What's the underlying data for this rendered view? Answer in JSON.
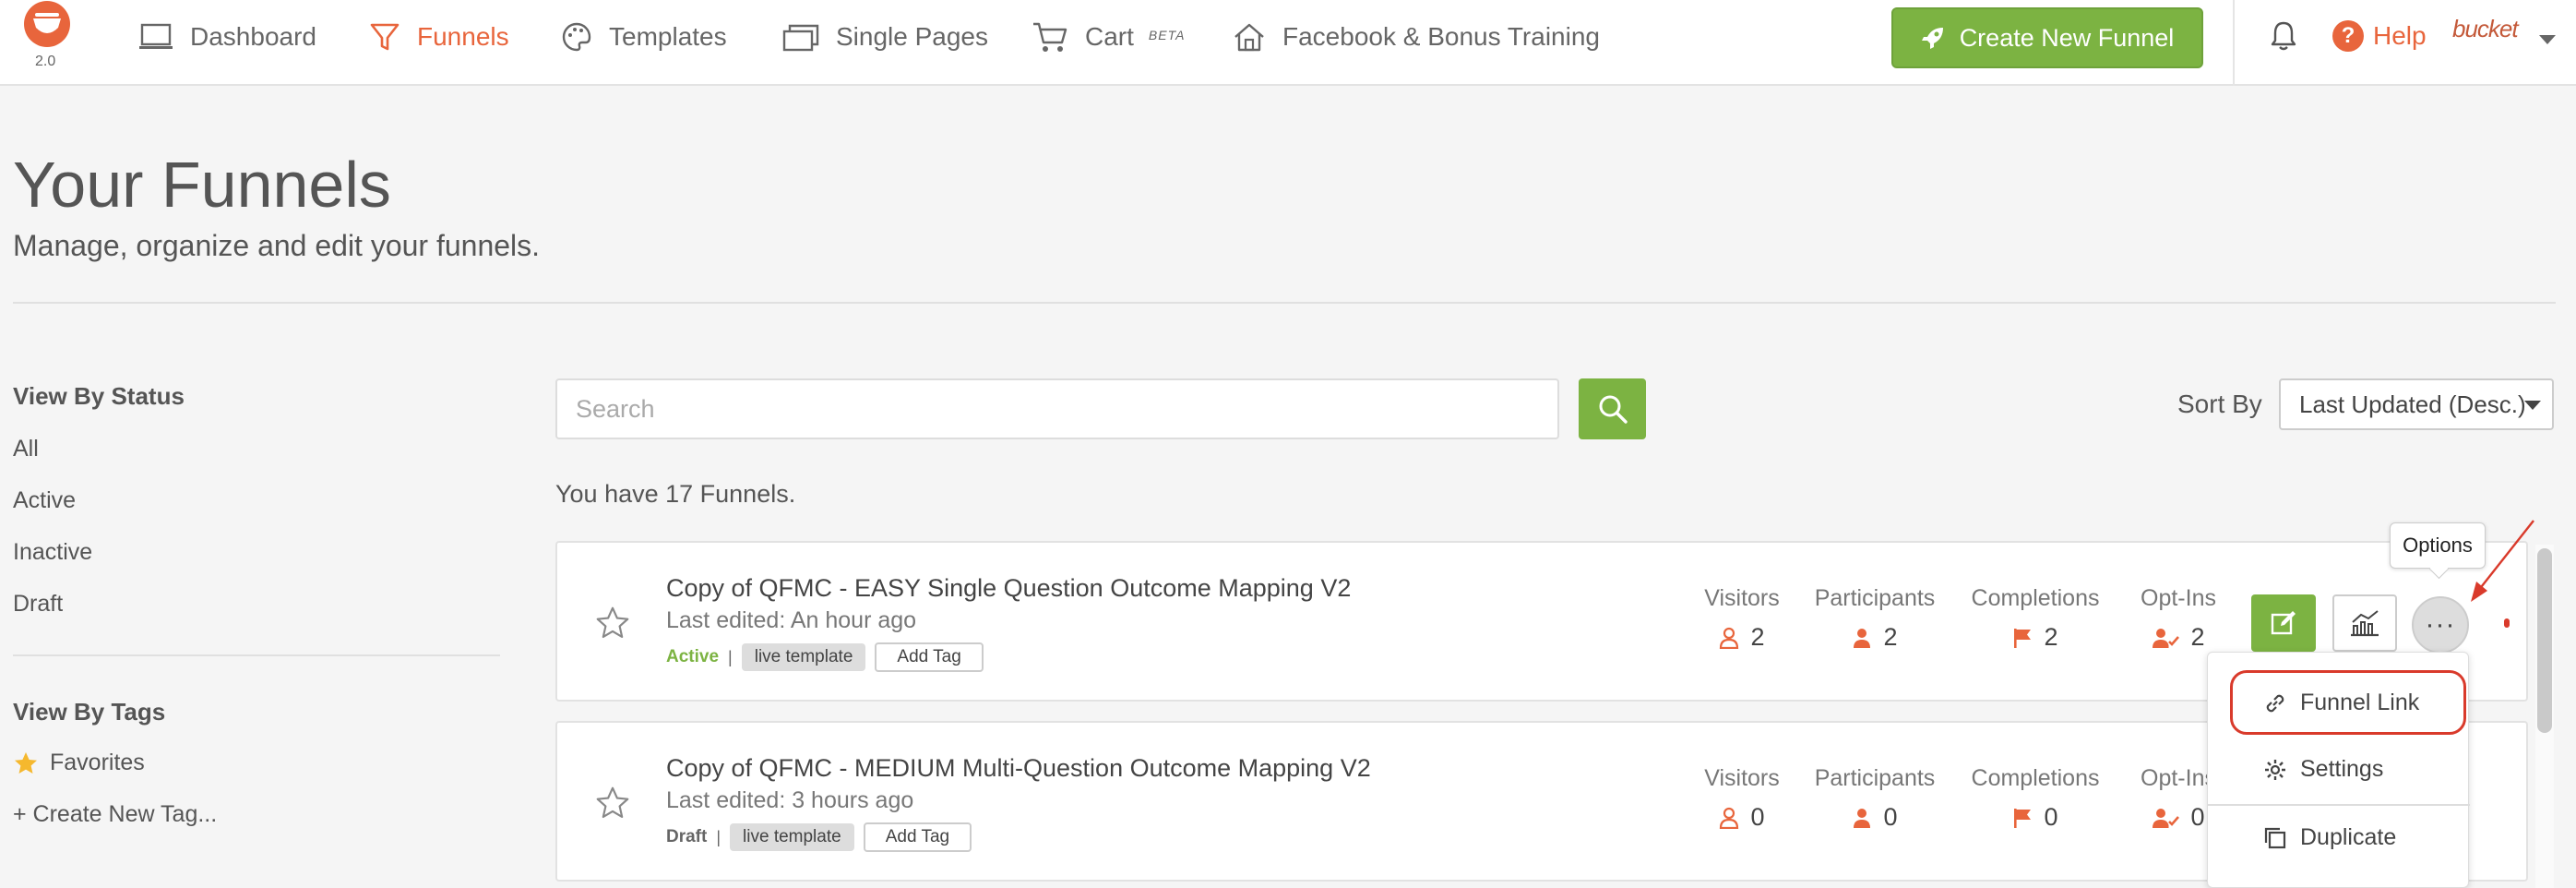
{
  "nav": {
    "logo_version": "2.0",
    "items": [
      {
        "label": "Dashboard",
        "icon": "laptop-icon"
      },
      {
        "label": "Funnels",
        "icon": "funnel-icon",
        "active": true
      },
      {
        "label": "Templates",
        "icon": "palette-icon"
      },
      {
        "label": "Single Pages",
        "icon": "pages-icon"
      },
      {
        "label": "Cart",
        "icon": "cart-icon",
        "badge": "BETA"
      },
      {
        "label": "Facebook & Bonus Training",
        "icon": "home-icon"
      }
    ],
    "create_button": "Create New Funnel",
    "help_label": "Help",
    "help_symbol": "?",
    "account_logo_text": "bucket"
  },
  "header": {
    "title": "Your Funnels",
    "subtitle": "Manage, organize and edit your funnels."
  },
  "sidebar": {
    "status_heading": "View By Status",
    "status_items": [
      "All",
      "Active",
      "Inactive",
      "Draft"
    ],
    "tags_heading": "View By Tags",
    "favorites_label": "Favorites",
    "create_tag_label": "+ Create New Tag..."
  },
  "search": {
    "placeholder": "Search",
    "sort_label": "Sort By",
    "sort_value": "Last Updated (Desc.)",
    "count_text": "You have 17 Funnels."
  },
  "stat_labels": {
    "visitors": "Visitors",
    "participants": "Participants",
    "completions": "Completions",
    "optins": "Opt-Ins"
  },
  "funnels": [
    {
      "name": "Copy of QFMC - EASY Single Question Outcome Mapping V2",
      "edited": "Last edited: An hour ago",
      "status": "Active",
      "tag": "live template",
      "add_tag": "Add Tag",
      "visitors": "2",
      "participants": "2",
      "completions": "2",
      "optins": "2"
    },
    {
      "name": "Copy of QFMC - MEDIUM Multi-Question Outcome Mapping V2",
      "edited": "Last edited: 3 hours ago",
      "status": "Draft",
      "tag": "live template",
      "add_tag": "Add Tag",
      "visitors": "0",
      "participants": "0",
      "completions": "0",
      "optins": "0"
    }
  ],
  "options_tooltip": "Options",
  "options_button_glyph": "···",
  "options_menu": [
    "Funnel Link",
    "Settings",
    "Duplicate"
  ],
  "colors": {
    "accent_orange": "#e8653c",
    "brand_green": "#7cb342",
    "annotation_red": "#d93a2b"
  }
}
